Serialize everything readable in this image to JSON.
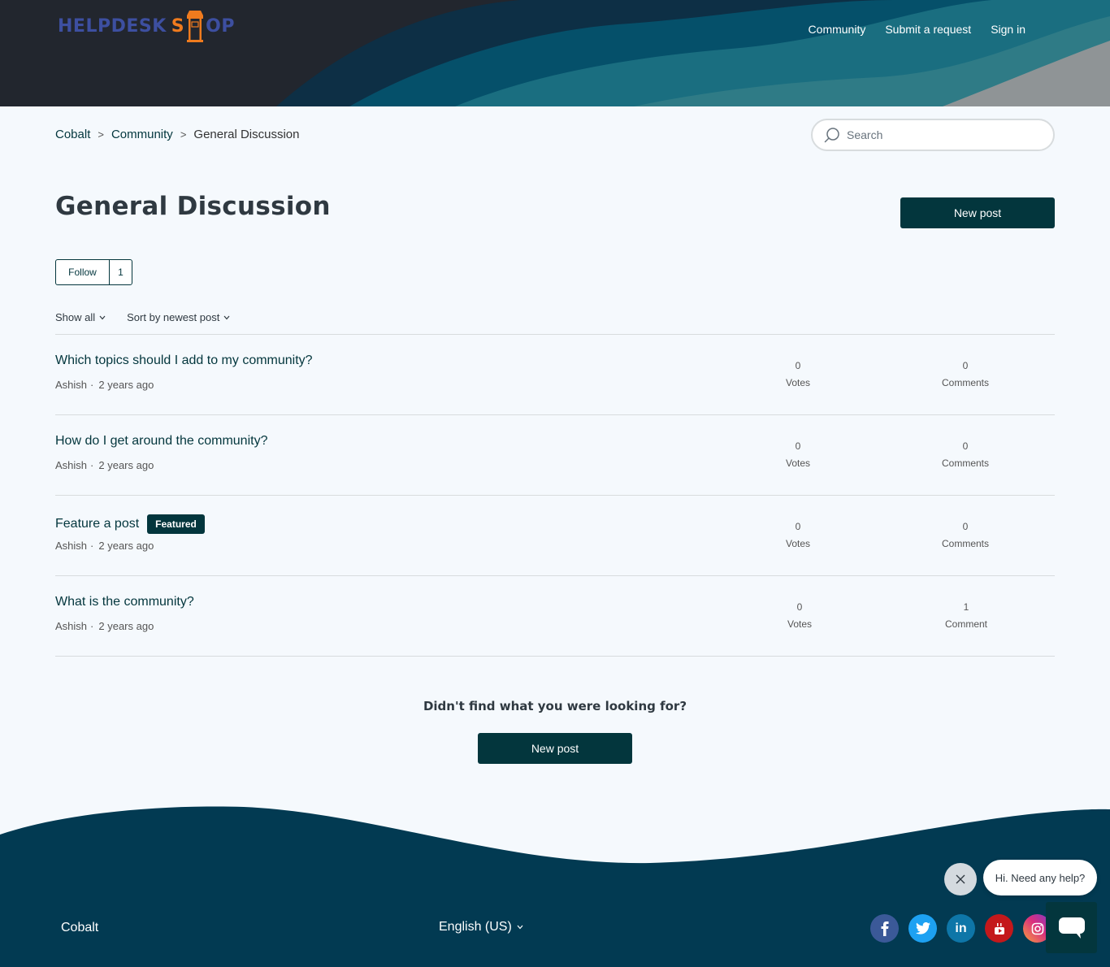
{
  "header": {
    "logo": {
      "part1": "HELPDESK",
      "part2": "S",
      "part3": "OP"
    },
    "nav": [
      "Community",
      "Submit a request",
      "Sign in"
    ]
  },
  "breadcrumb": [
    "Cobalt",
    "Community",
    "General Discussion"
  ],
  "search": {
    "placeholder": "Search"
  },
  "page_title": "General Discussion",
  "new_post_label": "New post",
  "follow": {
    "label": "Follow",
    "count": "1"
  },
  "filters": {
    "show": "Show all",
    "sort": "Sort by newest post"
  },
  "posts": [
    {
      "title": "Which topics should I add to my community?",
      "author": "Ashish",
      "time": "2 years ago",
      "votes": "0",
      "votes_label": "Votes",
      "comments": "0",
      "comments_label": "Comments"
    },
    {
      "title": "How do I get around the community?",
      "author": "Ashish",
      "time": "2 years ago",
      "votes": "0",
      "votes_label": "Votes",
      "comments": "0",
      "comments_label": "Comments"
    },
    {
      "title": "Feature a post",
      "badge": "Featured",
      "author": "Ashish",
      "time": "2 years ago",
      "votes": "0",
      "votes_label": "Votes",
      "comments": "0",
      "comments_label": "Comments"
    },
    {
      "title": "What is the community?",
      "author": "Ashish",
      "time": "2 years ago",
      "votes": "0",
      "votes_label": "Votes",
      "comments": "1",
      "comments_label": "Comment"
    }
  ],
  "not_found": "Didn't find what you were looking for?",
  "footer": {
    "brand": "Cobalt",
    "language": "English (US)"
  },
  "chat": {
    "greeting": "Hi. Need any help?"
  },
  "colors": {
    "primary": "#03363d",
    "header_bg": "#22262e",
    "logo_blue": "#3d4fa0",
    "logo_orange": "#f07b1e"
  },
  "social_icons": [
    "facebook-icon",
    "twitter-icon",
    "linkedin-icon",
    "youtube-icon",
    "instagram-icon"
  ]
}
